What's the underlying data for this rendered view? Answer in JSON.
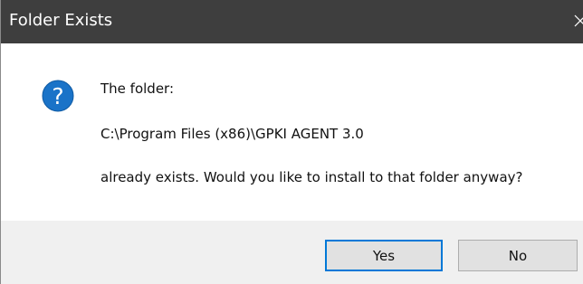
{
  "window": {
    "title": "Folder Exists",
    "close_icon": "close-icon"
  },
  "message": {
    "icon": "question-icon",
    "icon_color": "#1a73c8",
    "line1": "The folder:",
    "line2": "C:\\Program Files (x86)\\GPKI AGENT 3.0",
    "line3": "already exists. Would you like to install to that folder anyway?"
  },
  "buttons": {
    "yes_label": "Yes",
    "no_label": "No",
    "default_focus_color": "#0078d7"
  },
  "colors": {
    "titlebar": "#3e3e3e",
    "footer": "#f0f0f0",
    "button_face": "#e1e1e1"
  }
}
